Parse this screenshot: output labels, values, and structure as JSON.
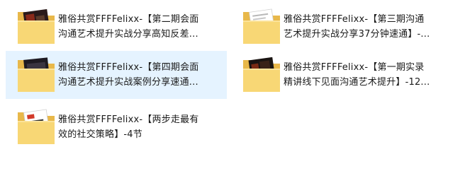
{
  "items": [
    {
      "name_line1": "雅俗共赏FFFFelixx-【第二期会面",
      "name_line2": "沟通艺术提升实战分享高知反差...",
      "selected": false,
      "thumb": "dark-video"
    },
    {
      "name_line1": "雅俗共赏FFFFelixx-【第三期沟通",
      "name_line2": "艺术提升实战分享37分钟速通】-...",
      "selected": false,
      "thumb": "white-doc"
    },
    {
      "name_line1": "雅俗共赏FFFFelixx-【第四期会面",
      "name_line2": "沟通艺术提升实战案例分享速通...",
      "selected": true,
      "thumb": "dark-video"
    },
    {
      "name_line1": "雅俗共赏FFFFelixx-【第一期实录",
      "name_line2": "精讲线下见面沟通艺术提升】-12...",
      "selected": false,
      "thumb": "dark-video"
    },
    {
      "name_line1": "雅俗共赏FFFFelixx-【两步走最有",
      "name_line2": "效的社交策略】-4节",
      "selected": false,
      "thumb": "red-doc"
    }
  ],
  "colors": {
    "folder_back": "#e8b84a",
    "folder_front": "#f8d775",
    "selection": "#e5f3ff"
  }
}
